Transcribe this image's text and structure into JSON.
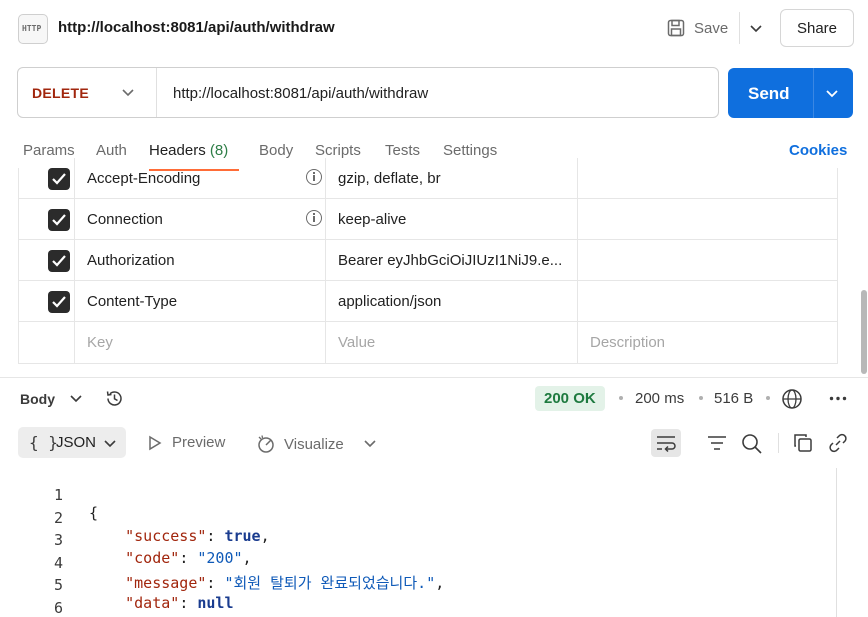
{
  "request": {
    "title": "http://localhost:8081/api/auth/withdraw",
    "http_icon_text": "HTTP",
    "method": "DELETE",
    "url": "http://localhost:8081/api/auth/withdraw",
    "save_label": "Save",
    "share_label": "Share",
    "send_label": "Send"
  },
  "tabs": {
    "params": "Params",
    "auth": "Auth",
    "headers": "Headers",
    "headers_count": "(8)",
    "body": "Body",
    "scripts": "Scripts",
    "tests": "Tests",
    "settings": "Settings",
    "cookies": "Cookies"
  },
  "headers_table": {
    "rows": [
      {
        "key": "Accept-Encoding",
        "value": "gzip, deflate, br",
        "checked": true,
        "info": true
      },
      {
        "key": "Connection",
        "value": "keep-alive",
        "checked": true,
        "info": true
      },
      {
        "key": "Authorization",
        "value": "Bearer eyJhbGciOiJIUzI1NiJ9.e...",
        "checked": true,
        "info": false
      },
      {
        "key": "Content-Type",
        "value": "application/json",
        "checked": true,
        "info": false
      }
    ],
    "placeholders": {
      "key": "Key",
      "value": "Value",
      "description": "Description"
    }
  },
  "response": {
    "body_label": "Body",
    "status": "200 OK",
    "time": "200 ms",
    "size": "516 B",
    "format_label": "JSON",
    "format_braces": "{ }",
    "preview_label": "Preview",
    "visualize_label": "Visualize",
    "code_lines": [
      {
        "n": "1",
        "indent": "",
        "key": "",
        "value": "",
        "vtype": "",
        "open": "{",
        "close": "",
        "comma": ""
      },
      {
        "n": "2",
        "indent": "    ",
        "key": "\"success\"",
        "value": "true",
        "vtype": "b",
        "open": "",
        "close": "",
        "comma": ","
      },
      {
        "n": "3",
        "indent": "    ",
        "key": "\"code\"",
        "value": "\"200\"",
        "vtype": "s",
        "open": "",
        "close": "",
        "comma": ","
      },
      {
        "n": "4",
        "indent": "    ",
        "key": "\"message\"",
        "value": "\"회원 탈퇴가 완료되었습니다.\"",
        "vtype": "s",
        "open": "",
        "close": "",
        "comma": ","
      },
      {
        "n": "5",
        "indent": "    ",
        "key": "\"data\"",
        "value": "null",
        "vtype": "b",
        "open": "",
        "close": "",
        "comma": ""
      },
      {
        "n": "6",
        "indent": "",
        "key": "",
        "value": "",
        "vtype": "",
        "open": "",
        "close": "}",
        "comma": ""
      }
    ]
  },
  "colors": {
    "send": "#0f6fde",
    "method": "#a1260d",
    "status_bg": "#e3f2e8",
    "status_text": "#1e7a3f",
    "active_tab_underline": "#ff6c37"
  }
}
